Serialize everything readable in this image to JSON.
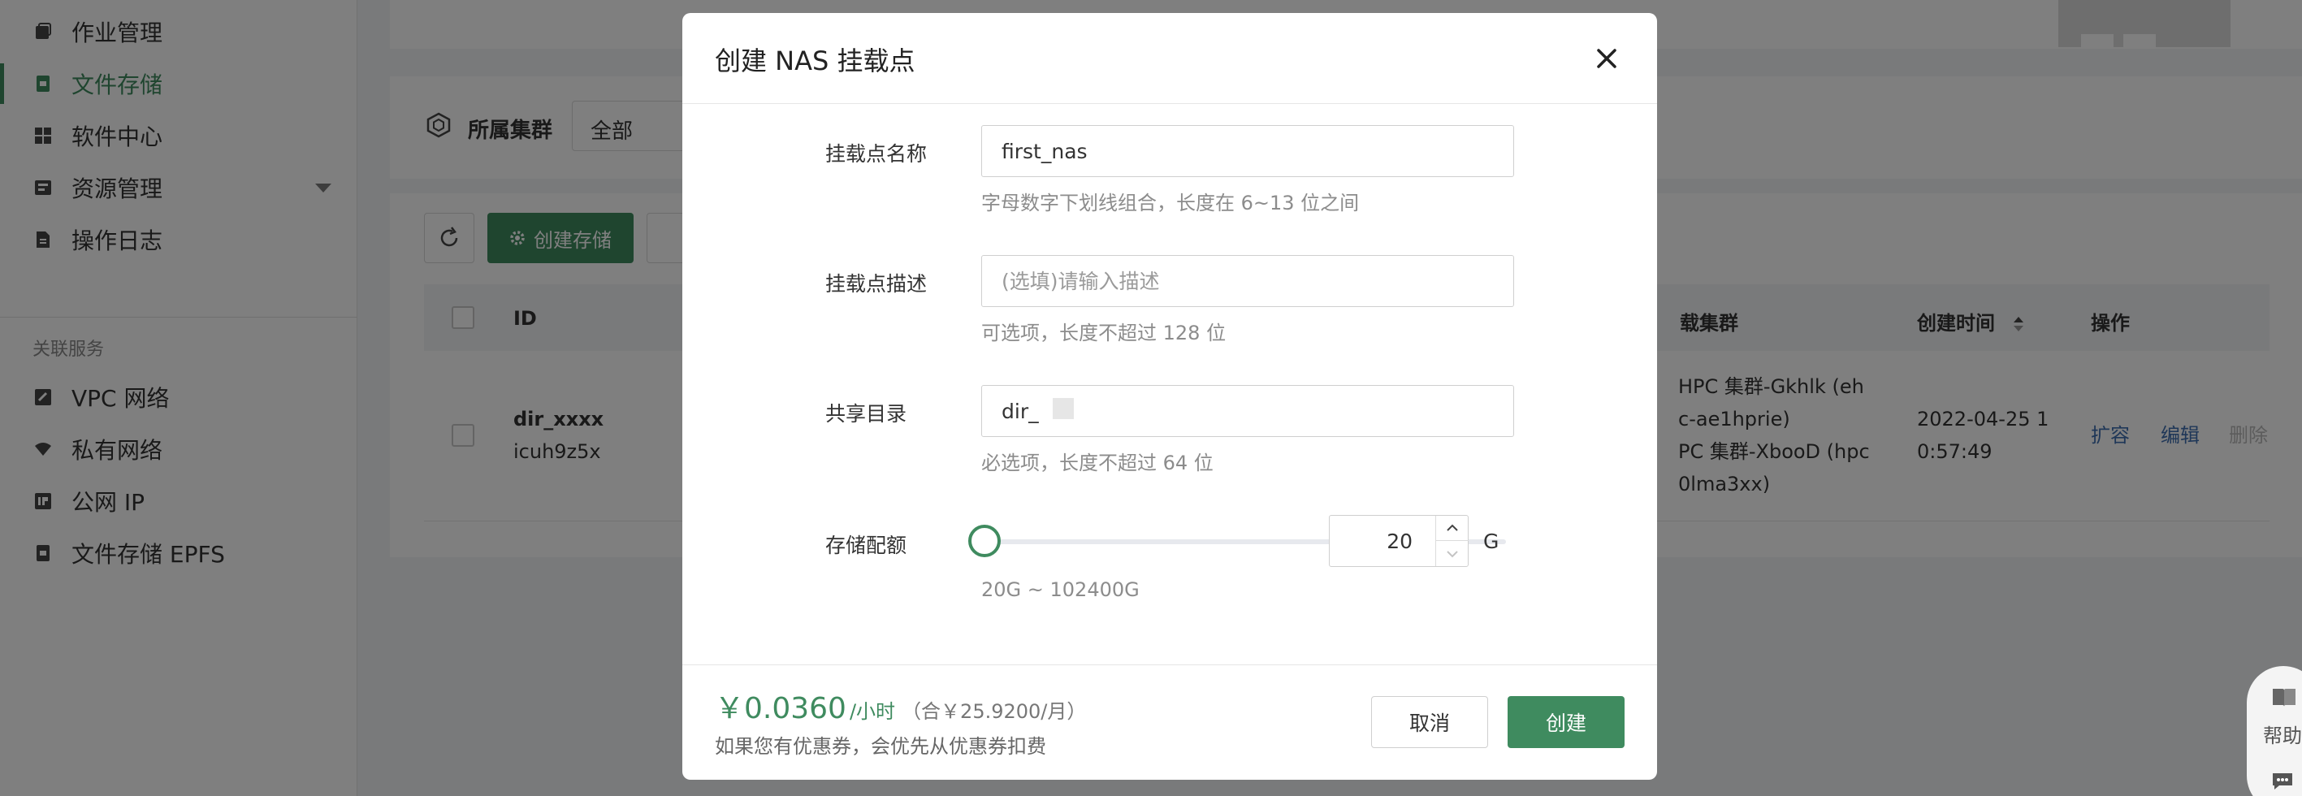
{
  "sidebar": {
    "items": [
      {
        "label": "作业管理",
        "icon": "job-management-icon"
      },
      {
        "label": "文件存储",
        "icon": "file-storage-icon"
      },
      {
        "label": "软件中心",
        "icon": "software-center-icon"
      },
      {
        "label": "资源管理",
        "icon": "resource-management-icon"
      },
      {
        "label": "操作日志",
        "icon": "operation-log-icon"
      }
    ],
    "group_label": "关联服务",
    "related_items": [
      {
        "label": "VPC 网络",
        "icon": "vpc-icon"
      },
      {
        "label": "私有网络",
        "icon": "private-network-icon"
      },
      {
        "label": "公网 IP",
        "icon": "public-ip-icon"
      },
      {
        "label": "文件存储 EPFS",
        "icon": "epfs-icon"
      }
    ]
  },
  "filter": {
    "label": "所属集群",
    "value": "全部"
  },
  "toolbar": {
    "create_storage_label": "创建存储"
  },
  "table": {
    "headers": {
      "id": "ID",
      "cluster": "载集群",
      "created": "创建时间",
      "ops": "操作"
    },
    "row": {
      "id_line1": "dir_xxxx",
      "id_line2": "icuh9z5x",
      "cluster_lines": [
        "HPC 集群-Gkhlk (eh",
        "c-ae1hprie)",
        "PC 集群-XbooD (hpc",
        "0lma3xx)"
      ],
      "created_lines": [
        "2022-04-25 1",
        "0:57:49"
      ],
      "ops": {
        "expand": "扩容",
        "edit": "编辑",
        "delete": "删除"
      }
    }
  },
  "help": {
    "label": "帮助"
  },
  "modal": {
    "title": "创建 NAS 挂载点",
    "fields": {
      "name": {
        "label": "挂载点名称",
        "value": "first_nas",
        "hint": "字母数字下划线组合，长度在 6~13 位之间"
      },
      "desc": {
        "label": "挂载点描述",
        "placeholder": "(选填)请输入描述",
        "hint": "可选项，长度不超过 128 位"
      },
      "dir": {
        "label": "共享目录",
        "value": "dir_",
        "hint": "必选项，长度不超过 64 位"
      },
      "quota": {
        "label": "存储配额",
        "value": "20",
        "unit": "G",
        "range": "20G ~ 102400G",
        "min": 20,
        "max": 102400
      }
    },
    "footer": {
      "price": "￥0.0360",
      "per": "/小时",
      "monthly": "（合￥25.9200/月）",
      "coupon_note": "如果您有优惠券，会优先从优惠券扣费",
      "cancel": "取消",
      "create": "创建"
    }
  },
  "colors": {
    "accent": "#3f8b5f",
    "link": "#3f6fb0",
    "disabled": "#b8b8b8"
  }
}
